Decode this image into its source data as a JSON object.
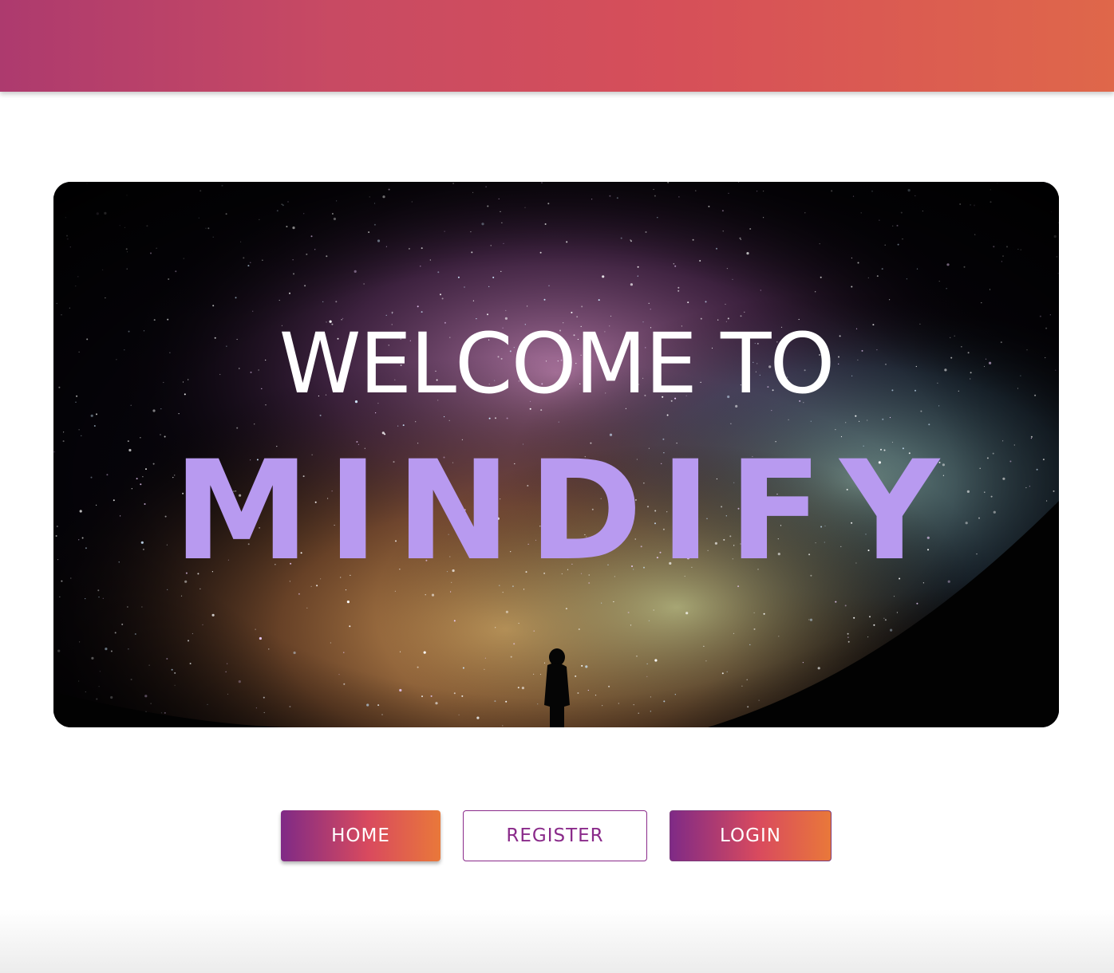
{
  "header": {
    "gradient_colors": [
      "#ad3a6e",
      "#d64f59",
      "#df674a"
    ]
  },
  "hero": {
    "image": "starry-night-sky-with-person-silhouette",
    "welcome_text": "WELCOME TO",
    "brand_text": "MINDIFY",
    "brand_color": "#b89af0"
  },
  "buttons": {
    "home_label": "HOME",
    "register_label": "REGISTER",
    "login_label": "LOGIN",
    "accent_gradient": [
      "#7f2a86",
      "#d94a5e",
      "#e9783a"
    ],
    "outline_color": "#8a2a8a"
  }
}
